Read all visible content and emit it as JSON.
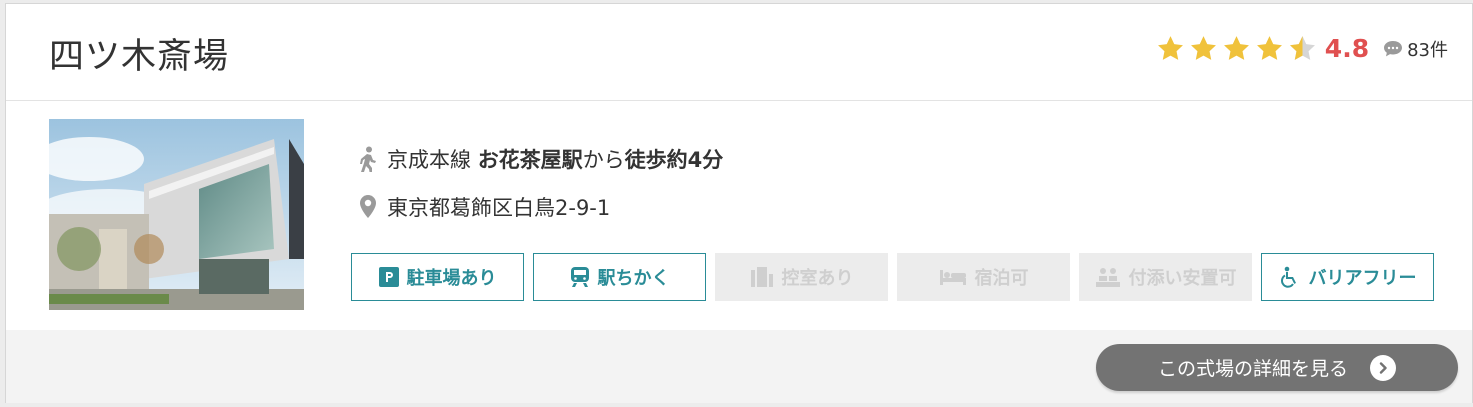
{
  "venue": {
    "name": "四ツ木斎場",
    "rating": {
      "stars": 4.5,
      "score": "4.8",
      "review_count": "83件",
      "star_color": "#f0c23b",
      "score_color": "#e05050"
    },
    "photo_icon": "building-photo",
    "access": {
      "line": "京成本線",
      "station": "お花茶屋駅",
      "connector": "から",
      "walk": "徒歩約4分"
    },
    "address": "東京都葛飾区白鳥2-9-1",
    "tags": [
      {
        "label": "駐車場あり",
        "icon": "parking-icon",
        "active": true
      },
      {
        "label": "駅ちかく",
        "icon": "train-icon",
        "active": true
      },
      {
        "label": "控室あり",
        "icon": "waiting-room-icon",
        "active": false
      },
      {
        "label": "宿泊可",
        "icon": "bed-icon",
        "active": false
      },
      {
        "label": "付添い安置可",
        "icon": "attendance-icon",
        "active": false
      },
      {
        "label": "バリアフリー",
        "icon": "wheelchair-icon",
        "active": true
      }
    ],
    "detail_button": "この式場の詳細を見る",
    "accent_color": "#2a8c97"
  }
}
